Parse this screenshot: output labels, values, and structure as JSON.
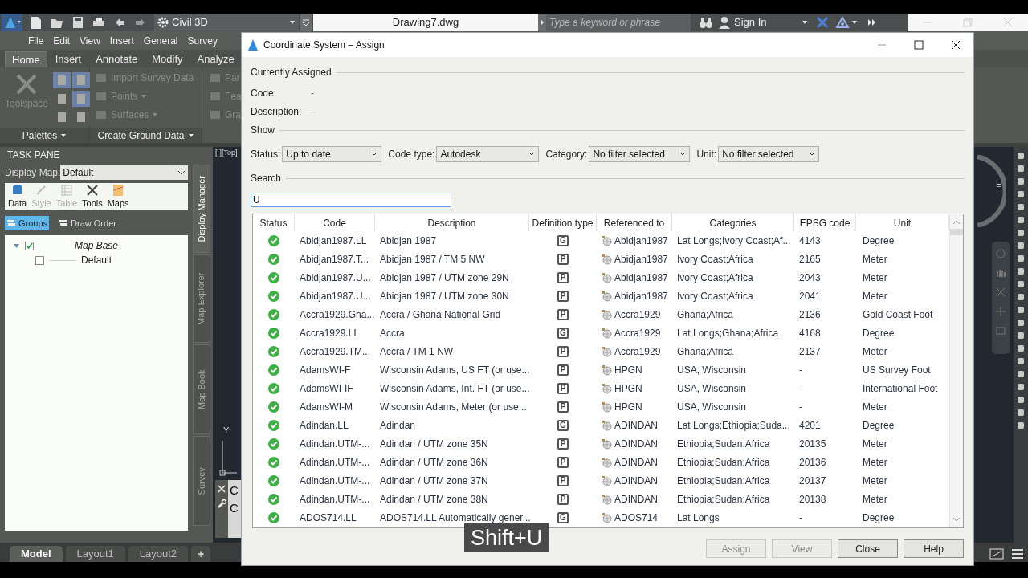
{
  "app": {
    "workspace": "Civil 3D",
    "document_title": "Drawing7.dwg",
    "search": {
      "placeholder": "Type a keyword or phrase"
    },
    "sign_in": "Sign In",
    "menu": [
      "File",
      "Edit",
      "View",
      "Insert",
      "General",
      "Survey"
    ],
    "ribbon_tabs": [
      {
        "label": "Home",
        "selected": true
      },
      {
        "label": "Insert",
        "selected": false
      },
      {
        "label": "Annotate",
        "selected": false
      },
      {
        "label": "Modify",
        "selected": false
      },
      {
        "label": "Analyze",
        "selected": false
      }
    ],
    "palettes_panel": {
      "title": "Palettes",
      "toolspace": "Toolspace"
    },
    "ground_panel": {
      "title": "Create Ground Data",
      "tools": [
        {
          "label": "Import Survey Data",
          "dropdown": false
        },
        {
          "label": "Points",
          "dropdown": true
        },
        {
          "label": "Surfaces",
          "dropdown": true
        }
      ]
    },
    "cut_panel_tools": [
      "Par",
      "Fea",
      "Gra"
    ]
  },
  "task_pane": {
    "title": "TASK PANE",
    "display_map": {
      "label": "Display Map:",
      "value": "Default"
    },
    "tools": [
      {
        "label": "Data",
        "disabled": false
      },
      {
        "label": "Style",
        "disabled": true
      },
      {
        "label": "Table",
        "disabled": true
      },
      {
        "label": "Tools",
        "disabled": false
      },
      {
        "label": "Maps",
        "disabled": false
      }
    ],
    "view_tabs": [
      {
        "label": "Groups",
        "selected": true
      },
      {
        "label": "Draw Order",
        "selected": false
      }
    ],
    "tree": [
      {
        "label": "Map Base",
        "checked": true,
        "expanded": true,
        "children": [
          {
            "label": "Default",
            "checked": false
          }
        ]
      }
    ],
    "side_tabs": [
      {
        "label": "Display Manager",
        "selected": true
      },
      {
        "label": "Map Explorer",
        "selected": false
      },
      {
        "label": "Map Book",
        "selected": false
      },
      {
        "label": "Survey",
        "selected": false
      }
    ]
  },
  "viewport": {
    "view_label": "[-][Top]",
    "axis_label": "Y",
    "compass_label": "E",
    "command_lines": [
      "C",
      "C"
    ]
  },
  "layout_tabs": [
    {
      "label": "Model",
      "selected": true
    },
    {
      "label": "Layout1",
      "selected": false
    },
    {
      "label": "Layout2",
      "selected": false
    }
  ],
  "add_tab": "+",
  "dialog": {
    "title": "Coordinate System – Assign",
    "currently_assigned": {
      "heading": "Currently Assigned",
      "fields": [
        {
          "label": "Code:",
          "value": "-"
        },
        {
          "label": "Description:",
          "value": "-"
        }
      ]
    },
    "show": {
      "heading": "Show",
      "filters": [
        {
          "label": "Status:",
          "value": "Up to date"
        },
        {
          "label": "Code type:",
          "value": "Autodesk"
        },
        {
          "label": "Category:",
          "value": "No filter selected"
        },
        {
          "label": "Unit:",
          "value": "No filter selected"
        }
      ]
    },
    "search": {
      "heading": "Search",
      "value": "U"
    },
    "table": {
      "columns": [
        "Status",
        "Code",
        "Description",
        "Definition type",
        "Referenced to",
        "Categories",
        "EPSG code",
        "Unit"
      ],
      "rows": [
        {
          "up_to_date": true,
          "code": "Abidjan1987.LL",
          "description": "Abidjan 1987",
          "type": "G",
          "ref": "Abidjan1987",
          "categories": "Lat Longs;Ivory Coast;Af...",
          "epsg": "4143",
          "unit": "Degree"
        },
        {
          "up_to_date": true,
          "code": "Abidjan1987.T...",
          "description": "Abidjan 1987 / TM 5 NW",
          "type": "P",
          "ref": "Abidjan1987",
          "categories": "Ivory Coast;Africa",
          "epsg": "2165",
          "unit": "Meter"
        },
        {
          "up_to_date": true,
          "code": "Abidjan1987.U...",
          "description": "Abidjan 1987 / UTM zone 29N",
          "type": "P",
          "ref": "Abidjan1987",
          "categories": "Ivory Coast;Africa",
          "epsg": "2043",
          "unit": "Meter"
        },
        {
          "up_to_date": true,
          "code": "Abidjan1987.U...",
          "description": "Abidjan 1987 / UTM zone 30N",
          "type": "P",
          "ref": "Abidjan1987",
          "categories": "Ivory Coast;Africa",
          "epsg": "2041",
          "unit": "Meter"
        },
        {
          "up_to_date": true,
          "code": "Accra1929.Gha...",
          "description": "Accra / Ghana National Grid",
          "type": "P",
          "ref": "Accra1929",
          "categories": "Ghana;Africa",
          "epsg": "2136",
          "unit": "Gold Coast Foot"
        },
        {
          "up_to_date": true,
          "code": "Accra1929.LL",
          "description": "Accra",
          "type": "G",
          "ref": "Accra1929",
          "categories": "Lat Longs;Ghana;Africa",
          "epsg": "4168",
          "unit": "Degree"
        },
        {
          "up_to_date": true,
          "code": "Accra1929.TM...",
          "description": "Accra / TM 1 NW",
          "type": "P",
          "ref": "Accra1929",
          "categories": "Ghana;Africa",
          "epsg": "2137",
          "unit": "Meter"
        },
        {
          "up_to_date": true,
          "code": "AdamsWI-F",
          "description": "Wisconsin Adams, US FT (or use...",
          "type": "P",
          "ref": "HPGN",
          "categories": "USA, Wisconsin",
          "epsg": "-",
          "unit": "US Survey Foot"
        },
        {
          "up_to_date": true,
          "code": "AdamsWI-IF",
          "description": "Wisconsin Adams, Int. FT (or use...",
          "type": "P",
          "ref": "HPGN",
          "categories": "USA, Wisconsin",
          "epsg": "-",
          "unit": "International Foot"
        },
        {
          "up_to_date": true,
          "code": "AdamsWI-M",
          "description": "Wisconsin Adams, Meter (or use...",
          "type": "P",
          "ref": "HPGN",
          "categories": "USA, Wisconsin",
          "epsg": "-",
          "unit": "Meter"
        },
        {
          "up_to_date": true,
          "code": "Adindan.LL",
          "description": "Adindan",
          "type": "G",
          "ref": "ADINDAN",
          "categories": "Lat Longs;Ethiopia;Suda...",
          "epsg": "4201",
          "unit": "Degree"
        },
        {
          "up_to_date": true,
          "code": "Adindan.UTM-...",
          "description": "Adindan / UTM zone 35N",
          "type": "P",
          "ref": "ADINDAN",
          "categories": "Ethiopia;Sudan;Africa",
          "epsg": "20135",
          "unit": "Meter"
        },
        {
          "up_to_date": true,
          "code": "Adindan.UTM-...",
          "description": "Adindan / UTM zone 36N",
          "type": "P",
          "ref": "ADINDAN",
          "categories": "Ethiopia;Sudan;Africa",
          "epsg": "20136",
          "unit": "Meter"
        },
        {
          "up_to_date": true,
          "code": "Adindan.UTM-...",
          "description": "Adindan / UTM zone 37N",
          "type": "P",
          "ref": "ADINDAN",
          "categories": "Ethiopia;Sudan;Africa",
          "epsg": "20137",
          "unit": "Meter"
        },
        {
          "up_to_date": true,
          "code": "Adindan.UTM-...",
          "description": "Adindan / UTM zone 38N",
          "type": "P",
          "ref": "ADINDAN",
          "categories": "Ethiopia;Sudan;Africa",
          "epsg": "20138",
          "unit": "Meter"
        },
        {
          "up_to_date": true,
          "code": "ADOS714.LL",
          "description": "ADOS714.LL Automatically gener...",
          "type": "G",
          "ref": "ADOS714",
          "categories": "Lat Longs",
          "epsg": "-",
          "unit": "Degree"
        }
      ]
    },
    "buttons": [
      {
        "label": "Assign",
        "disabled": true
      },
      {
        "label": "View",
        "disabled": true
      },
      {
        "label": "Close",
        "disabled": false
      },
      {
        "label": "Help",
        "disabled": false
      }
    ]
  },
  "keystroke_overlay": "Shift+U"
}
